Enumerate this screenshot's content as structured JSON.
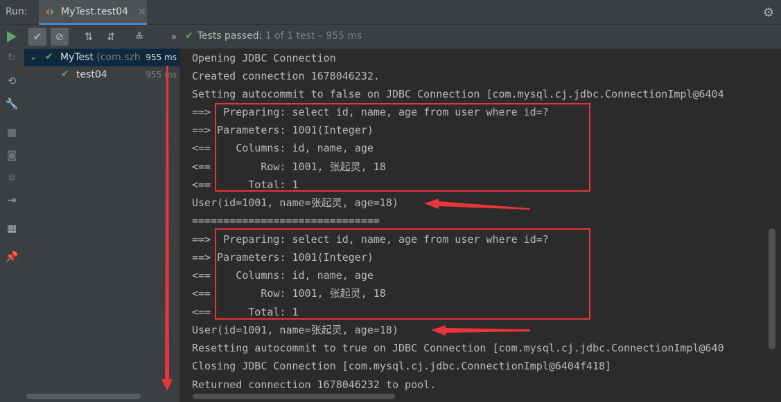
{
  "titlebar": {
    "run_label": "Run:",
    "tab_title": "MyTest.test04",
    "tab_close": "×",
    "settings_icon": "gear-icon"
  },
  "toolbar": {
    "more": "»",
    "status_prefix": "Tests passed:",
    "status_count": "1",
    "status_rest": "of 1 test – 955 ms"
  },
  "tree": {
    "root": {
      "name": "MyTest",
      "package": "(com.szh",
      "time": "955 ms"
    },
    "child": {
      "name": "test04",
      "time": "955 ms"
    }
  },
  "console": {
    "lines": [
      "Opening JDBC Connection",
      "Created connection 1678046232.",
      "Setting autocommit to false on JDBC Connection [com.mysql.cj.jdbc.ConnectionImpl@6404",
      "==>  Preparing: select id, name, age from user where id=?",
      "==> Parameters: 1001(Integer)",
      "<==    Columns: id, name, age",
      "<==        Row: 1001, 张起灵, 18",
      "<==      Total: 1",
      "User(id=1001, name=张起灵, age=18)",
      "==============================",
      "==>  Preparing: select id, name, age from user where id=?",
      "==> Parameters: 1001(Integer)",
      "<==    Columns: id, name, age",
      "<==        Row: 1001, 张起灵, 18",
      "<==      Total: 1",
      "User(id=1001, name=张起灵, age=18)",
      "Resetting autocommit to true on JDBC Connection [com.mysql.cj.jdbc.ConnectionImpl@640",
      "Closing JDBC Connection [com.mysql.cj.jdbc.ConnectionImpl@6404f418]",
      "Returned connection 1678046232 to pool."
    ]
  },
  "colors": {
    "annotation": "#e8353a",
    "pass": "#59a869",
    "selection": "#0d293e"
  }
}
